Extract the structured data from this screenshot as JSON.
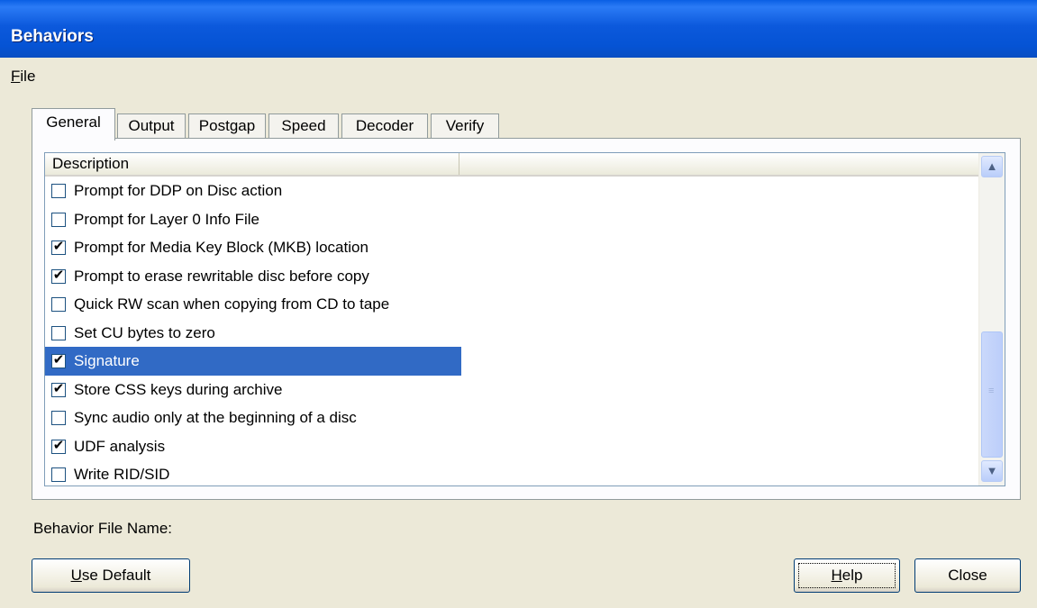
{
  "window": {
    "title": "Behaviors"
  },
  "menu": {
    "file_label": "File",
    "file_mnemonic": "F",
    "file_rest": "ile"
  },
  "tabs": [
    {
      "label": "General",
      "active": true
    },
    {
      "label": "Output"
    },
    {
      "label": "Postgap"
    },
    {
      "label": "Speed"
    },
    {
      "label": "Decoder"
    },
    {
      "label": "Verify"
    }
  ],
  "list": {
    "column_header": "Description",
    "items": [
      {
        "label": "Prompt for DDP on Disc action",
        "checked": false
      },
      {
        "label": "Prompt for Layer 0 Info File",
        "checked": false
      },
      {
        "label": "Prompt for Media Key Block (MKB) location",
        "checked": true
      },
      {
        "label": "Prompt to erase rewritable disc before copy",
        "checked": true
      },
      {
        "label": "Quick RW scan when copying from CD to tape",
        "checked": false
      },
      {
        "label": "Set CU bytes to zero",
        "checked": false
      },
      {
        "label": "Signature",
        "checked": true,
        "selected": true
      },
      {
        "label": "Store CSS keys during archive",
        "checked": true
      },
      {
        "label": "Sync audio only at the beginning of a disc",
        "checked": false
      },
      {
        "label": "UDF analysis",
        "checked": true
      },
      {
        "label": "Write RID/SID",
        "checked": false
      }
    ]
  },
  "behavior_file_label": "Behavior File Name:",
  "buttons": {
    "use_default": {
      "mnemonic": "U",
      "rest": "se Default"
    },
    "help": {
      "mnemonic": "H",
      "rest": "elp"
    },
    "close": "Close"
  },
  "colors": {
    "title_bar": "#0553d4",
    "selection": "#316ac5",
    "face": "#ece9d8"
  }
}
